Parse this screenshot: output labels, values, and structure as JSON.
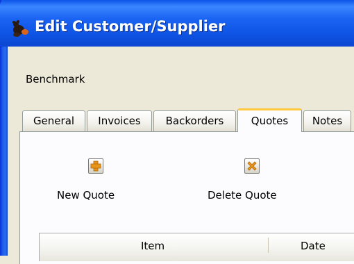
{
  "window": {
    "title": "Edit Customer/Supplier",
    "icon": "bear-app-icon"
  },
  "customer": {
    "name": "Benchmark"
  },
  "tabs": [
    {
      "label": "General",
      "active": false
    },
    {
      "label": "Invoices",
      "active": false
    },
    {
      "label": "Backorders",
      "active": false
    },
    {
      "label": "Quotes",
      "active": true
    },
    {
      "label": "Notes",
      "active": false
    }
  ],
  "toolbar": {
    "new_quote": {
      "label": "New Quote",
      "icon": "plus-icon",
      "icon_color": "#e8961a"
    },
    "delete_quote": {
      "label": "Delete Quote",
      "icon": "x-icon",
      "icon_color": "#e8961a"
    }
  },
  "table": {
    "columns": [
      "Item",
      "Date"
    ]
  },
  "colors": {
    "titlebar": "#0f55e6",
    "active_tab_highlight": "#ffc83c",
    "dialog_bg": "#ece9d8"
  }
}
